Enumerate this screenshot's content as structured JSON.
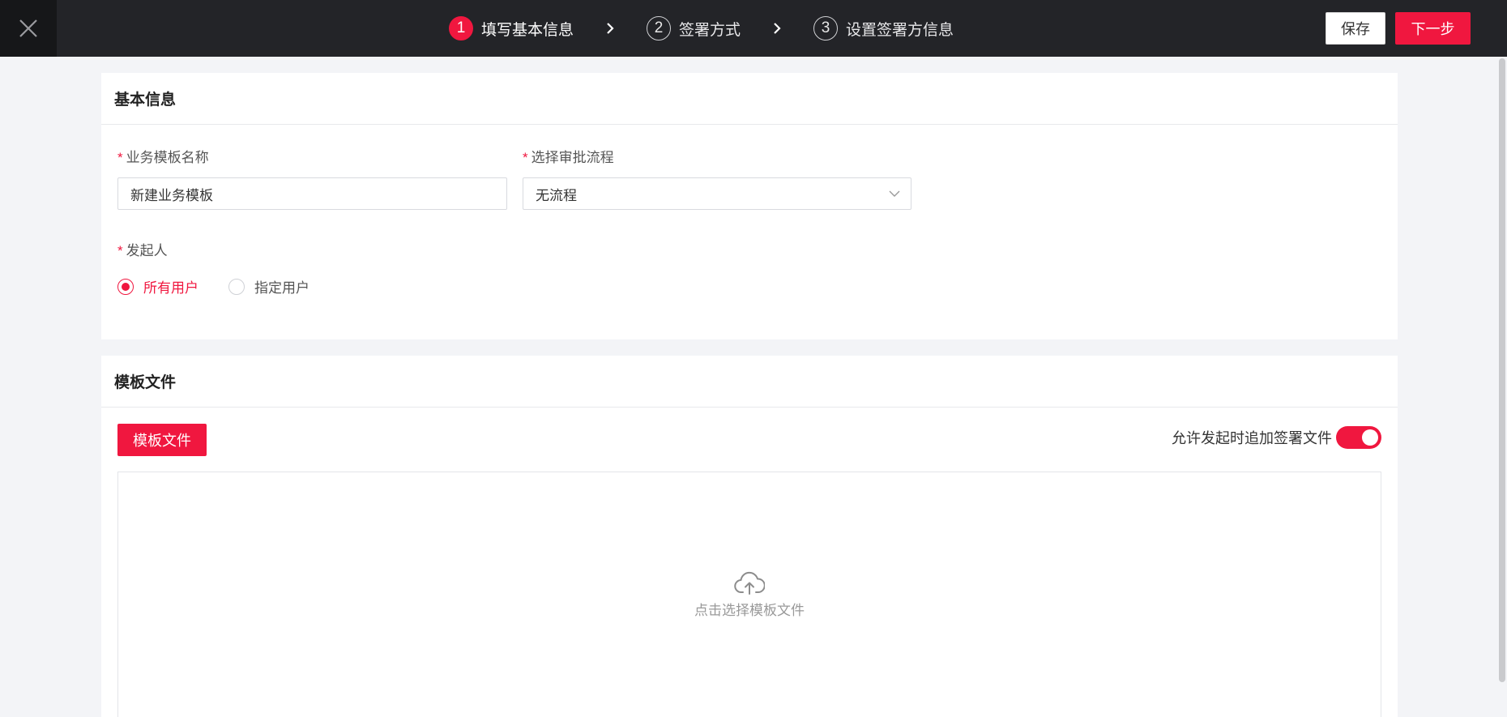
{
  "header": {
    "steps": [
      {
        "num": "1",
        "label": "填写基本信息",
        "active": true
      },
      {
        "num": "2",
        "label": "签署方式",
        "active": false
      },
      {
        "num": "3",
        "label": "设置签署方信息",
        "active": false
      }
    ],
    "save_label": "保存",
    "next_label": "下一步"
  },
  "basic_info": {
    "title": "基本信息",
    "template_name": {
      "required_mark": "*",
      "label": "业务模板名称",
      "value": "新建业务模板"
    },
    "approval_flow": {
      "required_mark": "*",
      "label": "选择审批流程",
      "value": "无流程"
    },
    "initiator": {
      "required_mark": "*",
      "label": "发起人",
      "options": [
        {
          "label": "所有用户",
          "checked": true
        },
        {
          "label": "指定用户",
          "checked": false
        }
      ]
    }
  },
  "template_files": {
    "title": "模板文件",
    "button_label": "模板文件",
    "toggle_label": "允许发起时追加签署文件",
    "toggle_on": true,
    "upload_text": "点击选择模板文件"
  },
  "colors": {
    "accent": "#f0173f",
    "header_bg": "#232428",
    "page_bg": "#f3f4f7"
  }
}
